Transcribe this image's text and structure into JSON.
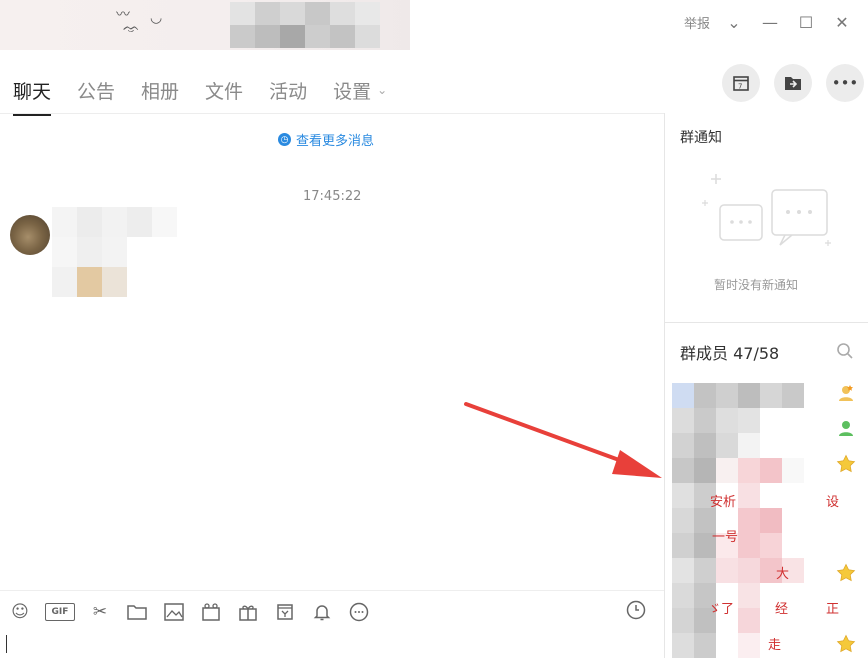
{
  "window": {
    "report_label": "举报",
    "controls": [
      "chevron-down",
      "minimize",
      "maximize",
      "close"
    ]
  },
  "tabs": [
    {
      "label": "聊天",
      "active": true
    },
    {
      "label": "公告",
      "active": false
    },
    {
      "label": "相册",
      "active": false
    },
    {
      "label": "文件",
      "active": false
    },
    {
      "label": "活动",
      "active": false
    },
    {
      "label": "设置",
      "active": false,
      "has_dropdown": true
    }
  ],
  "toolbar_right": [
    "calendar-icon",
    "folder-upload-icon",
    "more-icon"
  ],
  "chat": {
    "view_more_label": "查看更多消息",
    "timestamp": "17:45:22"
  },
  "input_toolbar": [
    "emoji-icon",
    "gif-icon",
    "scissors-icon",
    "folder-icon",
    "image-icon",
    "video-icon",
    "gift-icon",
    "shopping-icon",
    "bell-icon",
    "more-circle-icon"
  ],
  "gif_label": "GIF",
  "notice": {
    "title": "群通知",
    "empty_text": "暂时没有新通知"
  },
  "members": {
    "title_prefix": "群成员",
    "count": "47/58",
    "fragments": [
      "安析",
      "设",
      "一号",
      "大",
      "ゞ了",
      "经",
      "走",
      "正"
    ]
  },
  "colors": {
    "accent": "#2a8ae0",
    "arrow": "#e8403a",
    "member_red": "#d03030"
  }
}
